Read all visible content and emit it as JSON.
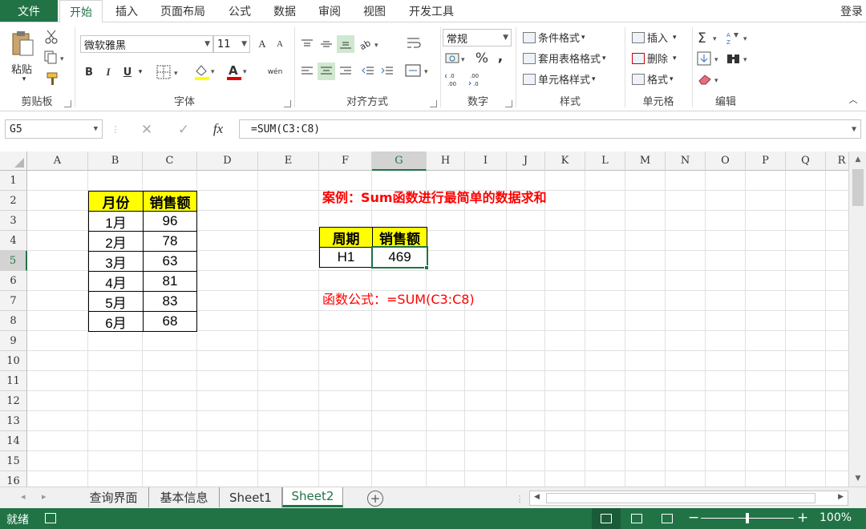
{
  "ribbon_tabs": {
    "file": "文件",
    "items": [
      "开始",
      "插入",
      "页面布局",
      "公式",
      "数据",
      "审阅",
      "视图",
      "开发工具"
    ],
    "active": "开始",
    "login": "登录"
  },
  "clipboard": {
    "paste": "粘贴",
    "label": "剪贴板"
  },
  "font": {
    "family": "微软雅黑",
    "size": "11",
    "bold": "B",
    "italic": "I",
    "underline": "U",
    "grow": "A",
    "shrink": "A",
    "phonetic": "wén",
    "label": "字体"
  },
  "alignment": {
    "label": "对齐方式"
  },
  "number": {
    "format": "常规",
    "percent": "%",
    "comma": ",",
    "label": "数字"
  },
  "styles": {
    "conditional": "条件格式",
    "table": "套用表格格式",
    "cell": "单元格样式",
    "label": "样式"
  },
  "cells": {
    "insert": "插入",
    "delete": "删除",
    "format": "格式",
    "label": "单元格"
  },
  "editing": {
    "label": "编辑"
  },
  "formula_bar": {
    "name_box": "G5",
    "formula": "=SUM(C3:C8)",
    "fx": "fx"
  },
  "columns": [
    "A",
    "B",
    "C",
    "D",
    "E",
    "F",
    "G",
    "H",
    "I",
    "J",
    "K",
    "L",
    "M",
    "N",
    "O",
    "P",
    "Q",
    "R"
  ],
  "rows": [
    "1",
    "2",
    "3",
    "4",
    "5",
    "6",
    "7",
    "8",
    "9",
    "10",
    "11",
    "12",
    "13",
    "14",
    "15",
    "16"
  ],
  "selected": {
    "column": "G",
    "row": "5"
  },
  "sales_table": {
    "headers": [
      "月份",
      "销售额"
    ],
    "rows": [
      [
        "1月",
        "96"
      ],
      [
        "2月",
        "78"
      ],
      [
        "3月",
        "63"
      ],
      [
        "4月",
        "81"
      ],
      [
        "5月",
        "83"
      ],
      [
        "6月",
        "68"
      ]
    ]
  },
  "example_title": "案例：Sum函数进行最简单的数据求和",
  "result_table": {
    "headers": [
      "周期",
      "销售额"
    ],
    "row": [
      "H1",
      "469"
    ]
  },
  "formula_note": "函数公式：=SUM(C3:C8)",
  "sheets": [
    "查询界面",
    "基本信息",
    "Sheet1",
    "Sheet2"
  ],
  "active_sheet": "Sheet2",
  "status": {
    "text": "就绪",
    "zoom": "100%",
    "zoom_fraction": 0.5
  },
  "accent_color": "#217346"
}
